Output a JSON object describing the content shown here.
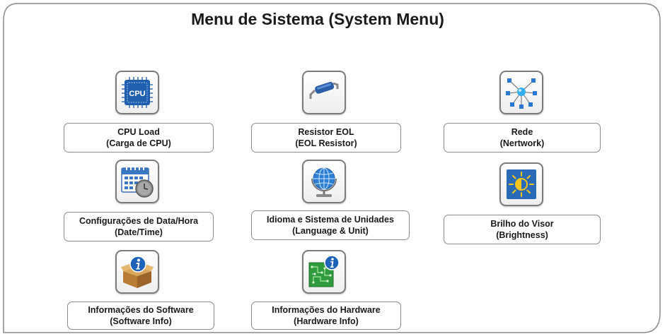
{
  "title": "Menu de Sistema (System Menu)",
  "items": [
    {
      "line1": "CPU Load",
      "line2": "(Carga de CPU)",
      "icon": "cpu-icon"
    },
    {
      "line1": "Resistor EOL",
      "line2": "(EOL Resistor)",
      "icon": "resistor-icon"
    },
    {
      "line1": "Rede",
      "line2": "(Nertwork)",
      "icon": "network-icon"
    },
    {
      "line1": "Configurações de Data/Hora",
      "line2": "(Date/Time)",
      "icon": "calendar-clock-icon"
    },
    {
      "line1": "Idioma e Sistema de Unidades",
      "line2": "(Language & Unit)",
      "icon": "globe-icon"
    },
    {
      "line1": "Brilho do Visor",
      "line2": "(Brightness)",
      "icon": "brightness-icon"
    },
    {
      "line1": "Informações do Software",
      "line2": "(Software Info)",
      "icon": "software-info-icon"
    },
    {
      "line1": "Informações do Hardware",
      "line2": "(Hardware Info)",
      "icon": "hardware-info-icon"
    }
  ],
  "icon_texts": {
    "cpu": "CPU"
  }
}
